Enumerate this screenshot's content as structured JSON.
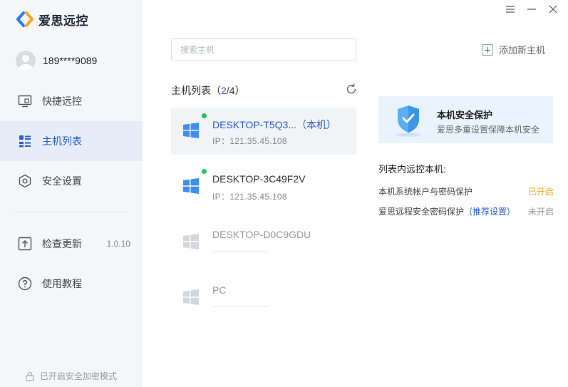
{
  "app": {
    "name": "爱思远控"
  },
  "user": {
    "phone": "189****9089"
  },
  "nav": [
    {
      "label": "快捷远控",
      "icon": "monitor-icon"
    },
    {
      "label": "主机列表",
      "icon": "list-icon"
    },
    {
      "label": "安全设置",
      "icon": "hexagon-shield-icon"
    },
    {
      "label": "检查更新",
      "icon": "upload-icon",
      "extra": "1.0.10"
    },
    {
      "label": "使用教程",
      "icon": "help-circle-icon"
    }
  ],
  "footer": {
    "secure_mode": "已开启安全加密模式"
  },
  "search": {
    "placeholder": "搜索主机"
  },
  "add_host": {
    "label": "添加新主机"
  },
  "host_list": {
    "title_prefix": "主机列表（",
    "online": "2",
    "separator": "/",
    "total": "4",
    "title_suffix": "）",
    "hosts": [
      {
        "name": "DESKTOP-T5Q3...（本机）",
        "ip": "IP：121.35.45.108",
        "online": true,
        "selected": true
      },
      {
        "name": "DESKTOP-3C49F2V",
        "ip": "IP：121.35.45.108",
        "online": true,
        "selected": false
      },
      {
        "name": "DESKTOP-D0C9GDU",
        "ip": "",
        "online": false,
        "selected": false
      },
      {
        "name": "PC",
        "ip": "",
        "online": false,
        "selected": false
      }
    ]
  },
  "security": {
    "card_title": "本机安全保护",
    "card_desc": "爱思多重设置保障本机安全",
    "remote_title": "列表内远控本机:",
    "items": [
      {
        "label": "本机系统帐户与密码保护",
        "link": "",
        "status": "已开启",
        "status_color": "#f5a623"
      },
      {
        "label": "爱思远程安全密码保护",
        "link": "（推荐设置）",
        "status": "未开启",
        "status_color": "#999999"
      }
    ]
  },
  "colors": {
    "accent": "#2a5bd7",
    "online": "#22c55e",
    "warning": "#f5a623"
  }
}
